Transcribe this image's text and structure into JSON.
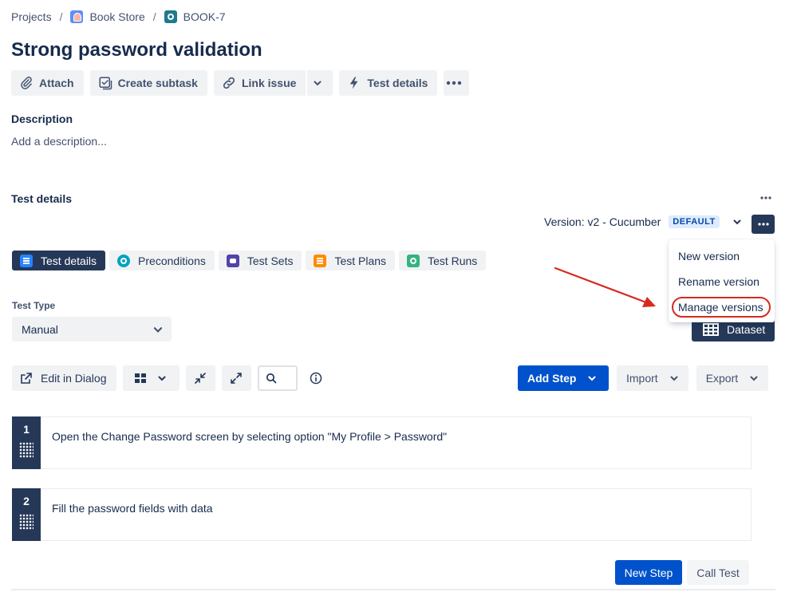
{
  "breadcrumb": {
    "projects": "Projects",
    "project": "Book Store",
    "issue_key": "BOOK-7",
    "separator": "/"
  },
  "issue": {
    "title": "Strong password validation"
  },
  "actions": {
    "attach": "Attach",
    "create_subtask": "Create subtask",
    "link_issue": "Link issue",
    "test_details": "Test details"
  },
  "description": {
    "heading": "Description",
    "placeholder": "Add a description..."
  },
  "test_details": {
    "heading": "Test details",
    "version_label": "Version: v2 - Cucumber",
    "version_badge": "DEFAULT"
  },
  "version_menu": {
    "items": [
      "New version",
      "Rename version",
      "Manage versions"
    ],
    "highlighted_item": "Manage versions",
    "highlight_color": "#d52b1e"
  },
  "tabs": [
    {
      "label": "Test details",
      "active": true,
      "icon": "list-icon"
    },
    {
      "label": "Preconditions",
      "active": false,
      "icon": "precondition-icon"
    },
    {
      "label": "Test Sets",
      "active": false,
      "icon": "test-set-icon"
    },
    {
      "label": "Test Plans",
      "active": false,
      "icon": "test-plan-icon"
    },
    {
      "label": "Test Runs",
      "active": false,
      "icon": "test-run-icon"
    }
  ],
  "test_type": {
    "label": "Test Type",
    "value": "Manual"
  },
  "dataset_button": "Dataset",
  "toolbar": {
    "edit_in_dialog": "Edit in Dialog",
    "add_step": "Add Step",
    "import": "Import",
    "export": "Export"
  },
  "steps": [
    {
      "number": "1",
      "action": "Open the Change Password screen by selecting option \"My Profile > Password\""
    },
    {
      "number": "2",
      "action": "Fill the password fields with data"
    }
  ],
  "footer_buttons": {
    "new_step": "New Step",
    "call_test": "Call Test"
  },
  "colors": {
    "primary": "#0052cc",
    "dark": "#253858",
    "badge_bg": "#deebff",
    "annotation": "#d52b1e"
  }
}
